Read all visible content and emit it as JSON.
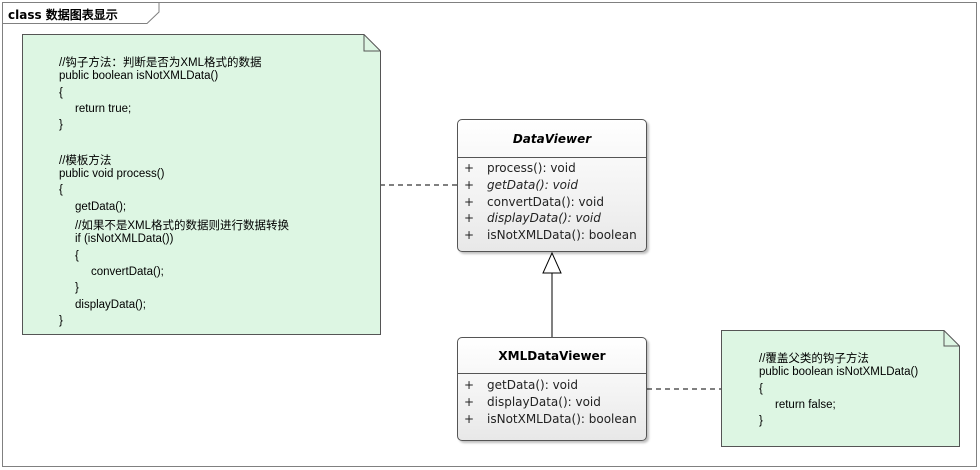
{
  "frame": {
    "title": "class 数据图表显示"
  },
  "notes": {
    "template_note": {
      "lines": [
        "//钩子方法：判断是否为XML格式的数据",
        "public boolean isNotXMLData()",
        "{",
        "return true;",
        "}",
        "",
        "//模板方法",
        "public void process()",
        "{",
        "getData();",
        "//如果不是XML格式的数据则进行数据转换",
        "if (isNotXMLData())",
        "{",
        "convertData();",
        "}",
        "displayData();",
        "}"
      ]
    },
    "override_note": {
      "lines": [
        "//覆盖父类的钩子方法",
        "public boolean isNotXMLData()",
        "{",
        "return false;",
        "}"
      ]
    }
  },
  "classes": {
    "data_viewer": {
      "name": "DataViewer",
      "operations": [
        {
          "visibility": "+",
          "signature": "process(): void",
          "abstract": false
        },
        {
          "visibility": "+",
          "signature": "getData(): void",
          "abstract": true
        },
        {
          "visibility": "+",
          "signature": "convertData(): void",
          "abstract": false
        },
        {
          "visibility": "+",
          "signature": "displayData(): void",
          "abstract": true
        },
        {
          "visibility": "+",
          "signature": "isNotXMLData(): boolean",
          "abstract": false
        }
      ]
    },
    "xml_data_viewer": {
      "name": "XMLDataViewer",
      "operations": [
        {
          "visibility": "+",
          "signature": "getData(): void",
          "abstract": false
        },
        {
          "visibility": "+",
          "signature": "displayData(): void",
          "abstract": false
        },
        {
          "visibility": "+",
          "signature": "isNotXMLData(): boolean",
          "abstract": false
        }
      ]
    }
  },
  "colors": {
    "note_fill": "#ddf6e3",
    "border": "#555555",
    "frame_border": "#808080"
  }
}
